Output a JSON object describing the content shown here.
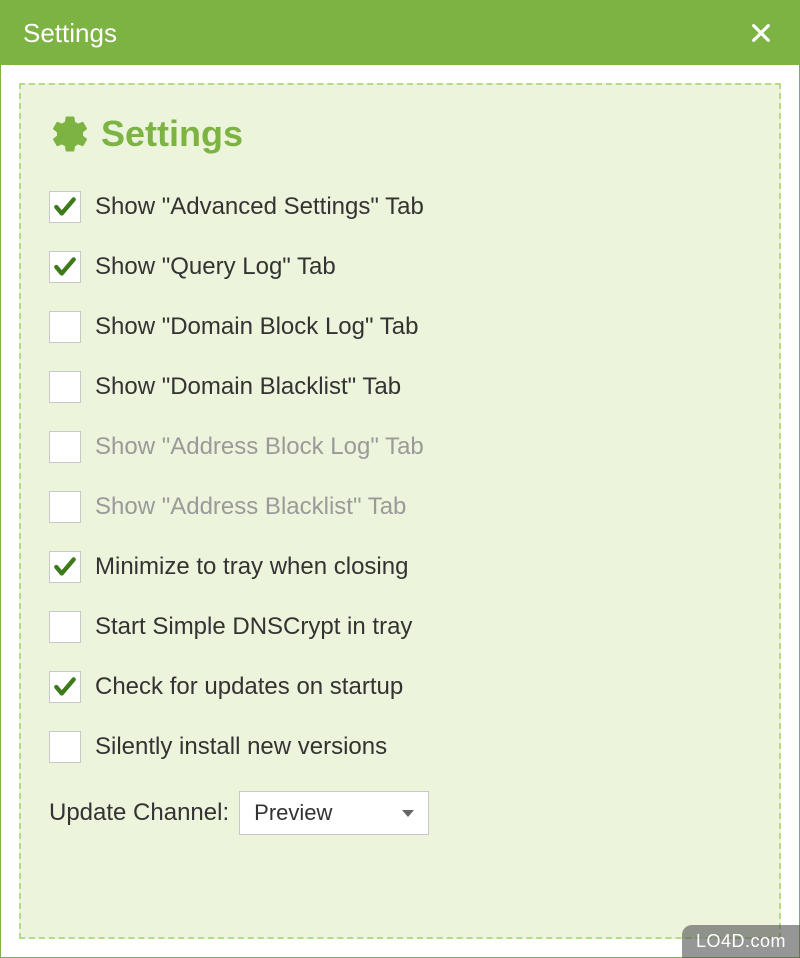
{
  "titlebar": {
    "title": "Settings"
  },
  "section": {
    "title": "Settings"
  },
  "settings": [
    {
      "label": "Show \"Advanced Settings\" Tab",
      "checked": true,
      "disabled": false,
      "name": "checkbox-advanced-settings"
    },
    {
      "label": "Show \"Query Log\" Tab",
      "checked": true,
      "disabled": false,
      "name": "checkbox-query-log"
    },
    {
      "label": "Show \"Domain Block Log\" Tab",
      "checked": false,
      "disabled": false,
      "name": "checkbox-domain-block-log"
    },
    {
      "label": "Show \"Domain Blacklist\" Tab",
      "checked": false,
      "disabled": false,
      "name": "checkbox-domain-blacklist"
    },
    {
      "label": "Show \"Address Block Log\" Tab",
      "checked": false,
      "disabled": true,
      "name": "checkbox-address-block-log"
    },
    {
      "label": "Show \"Address Blacklist\" Tab",
      "checked": false,
      "disabled": true,
      "name": "checkbox-address-blacklist"
    },
    {
      "label": "Minimize to tray when closing",
      "checked": true,
      "disabled": false,
      "name": "checkbox-minimize-tray"
    },
    {
      "label": "Start Simple DNSCrypt in tray",
      "checked": false,
      "disabled": false,
      "name": "checkbox-start-in-tray"
    },
    {
      "label": "Check for updates on startup",
      "checked": true,
      "disabled": false,
      "name": "checkbox-check-updates"
    },
    {
      "label": "Silently install new versions",
      "checked": false,
      "disabled": false,
      "name": "checkbox-silent-install"
    }
  ],
  "updateChannel": {
    "label": "Update Channel:",
    "value": "Preview"
  },
  "watermark": "LO4D.com"
}
